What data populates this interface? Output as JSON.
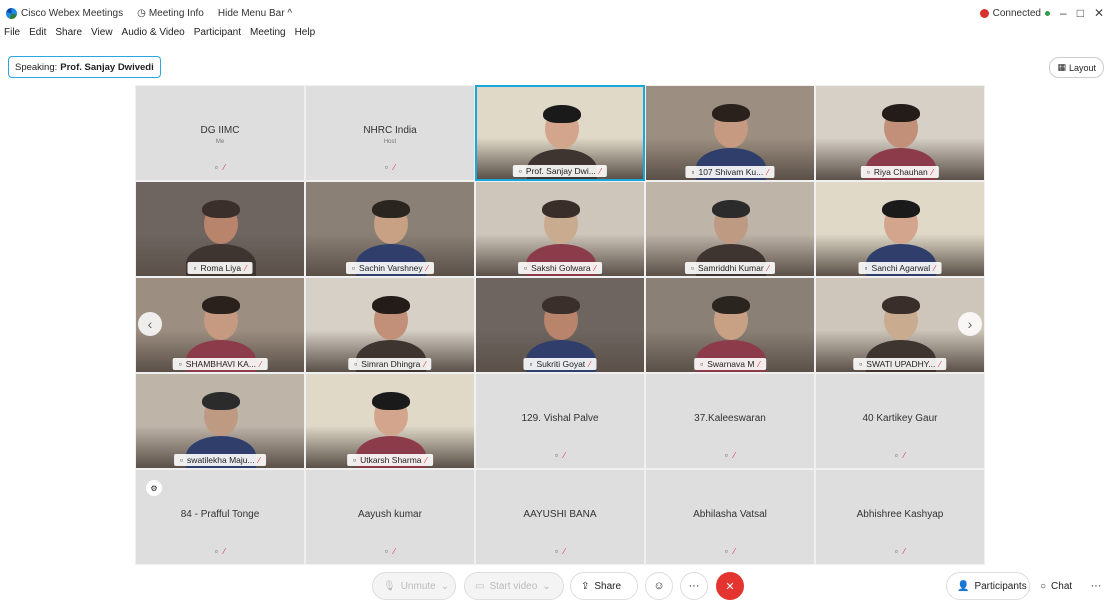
{
  "titlebar": {
    "app_name": "Cisco Webex Meetings",
    "meeting_info": "Meeting Info",
    "hide_menu": "Hide Menu Bar ^",
    "status": "Connected",
    "win_min": "–",
    "win_max": "□",
    "win_close": "✕"
  },
  "menu": [
    "File",
    "Edit",
    "Share",
    "View",
    "Audio & Video",
    "Participant",
    "Meeting",
    "Help"
  ],
  "speaking": {
    "prefix": "Speaking:",
    "name": "Prof. Sanjay Dwivedi"
  },
  "layout_label": "Layout",
  "tiles": [
    {
      "name": "DG IIMC",
      "sub": "Me",
      "video": false
    },
    {
      "name": "NHRC India",
      "sub": "Host",
      "video": false
    },
    {
      "name": "Prof. Sanjay Dwi...",
      "video": true,
      "active": true
    },
    {
      "name": "107 Shivam Ku...",
      "video": true
    },
    {
      "name": "Riya Chauhan",
      "video": true
    },
    {
      "name": "Roma Liya",
      "video": true
    },
    {
      "name": "Sachin Varshney",
      "video": true
    },
    {
      "name": "Sakshi Golwara",
      "video": true
    },
    {
      "name": "Samriddhi Kumar",
      "video": true
    },
    {
      "name": "Sanchi Agarwal",
      "video": true
    },
    {
      "name": "SHAMBHAVI KA...",
      "video": true
    },
    {
      "name": "Simran Dhingra",
      "video": true
    },
    {
      "name": "Sukriti Goyat",
      "video": true
    },
    {
      "name": "Swarnava M",
      "video": true
    },
    {
      "name": "SWATI UPADHY...",
      "video": true
    },
    {
      "name": "swatilekha Maju...",
      "video": true
    },
    {
      "name": "Utkarsh Sharma",
      "video": true
    },
    {
      "name": "129. Vishal Palve",
      "video": false
    },
    {
      "name": "37.Kaleeswaran",
      "video": false
    },
    {
      "name": "40 Kartikey Gaur",
      "video": false
    },
    {
      "name": "84 - Prafful Tonge",
      "video": false
    },
    {
      "name": "Aayush kumar",
      "video": false
    },
    {
      "name": "AAYUSHI BANA",
      "video": false
    },
    {
      "name": "Abhilasha Vatsal",
      "video": false
    },
    {
      "name": "Abhishree Kashyap",
      "video": false
    }
  ],
  "controls": {
    "unmute": "Unmute",
    "start_video": "Start video",
    "share": "Share",
    "participants": "Participants",
    "chat": "Chat",
    "more": "···"
  },
  "colors": {
    "accent": "#19a7d9",
    "end": "#e3342f",
    "status_red": "#d9322e"
  }
}
